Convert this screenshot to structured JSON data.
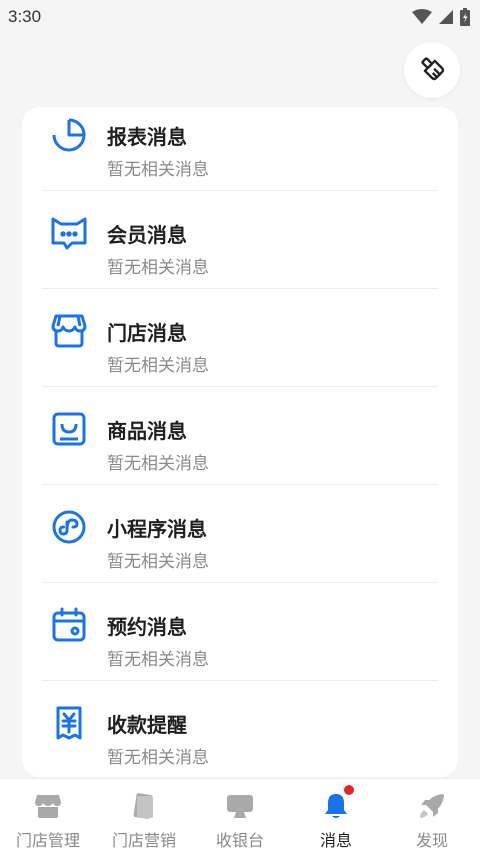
{
  "status_bar": {
    "time": "3:30",
    "icons": [
      "wifi-icon",
      "signal-icon",
      "battery-icon"
    ]
  },
  "clean_button": {
    "icon": "broom-icon"
  },
  "colors": {
    "accent": "#1a73e8",
    "tab_inactive": "#9a9a9a",
    "badge": "#e8222c"
  },
  "messages": [
    {
      "title": "报表消息",
      "subtitle": "暂无相关消息",
      "icon": "pie-chart-icon"
    },
    {
      "title": "会员消息",
      "subtitle": "暂无相关消息",
      "icon": "chat-bubble-icon"
    },
    {
      "title": "门店消息",
      "subtitle": "暂无相关消息",
      "icon": "store-icon"
    },
    {
      "title": "商品消息",
      "subtitle": "暂无相关消息",
      "icon": "shopping-bag-icon"
    },
    {
      "title": "小程序消息",
      "subtitle": "暂无相关消息",
      "icon": "mini-program-icon"
    },
    {
      "title": "预约消息",
      "subtitle": "暂无相关消息",
      "icon": "calendar-icon"
    },
    {
      "title": "收款提醒",
      "subtitle": "暂无相关消息",
      "icon": "yuan-receipt-icon"
    }
  ],
  "tabbar": {
    "tabs": [
      {
        "label": "门店管理",
        "icon": "store-tab-icon",
        "active": false
      },
      {
        "label": "门店营销",
        "icon": "marketing-tab-icon",
        "active": false
      },
      {
        "label": "收银台",
        "icon": "cashier-tab-icon",
        "active": false
      },
      {
        "label": "消息",
        "icon": "bell-tab-icon",
        "active": true,
        "badge": true
      },
      {
        "label": "发现",
        "icon": "discover-tab-icon",
        "active": false
      }
    ]
  }
}
